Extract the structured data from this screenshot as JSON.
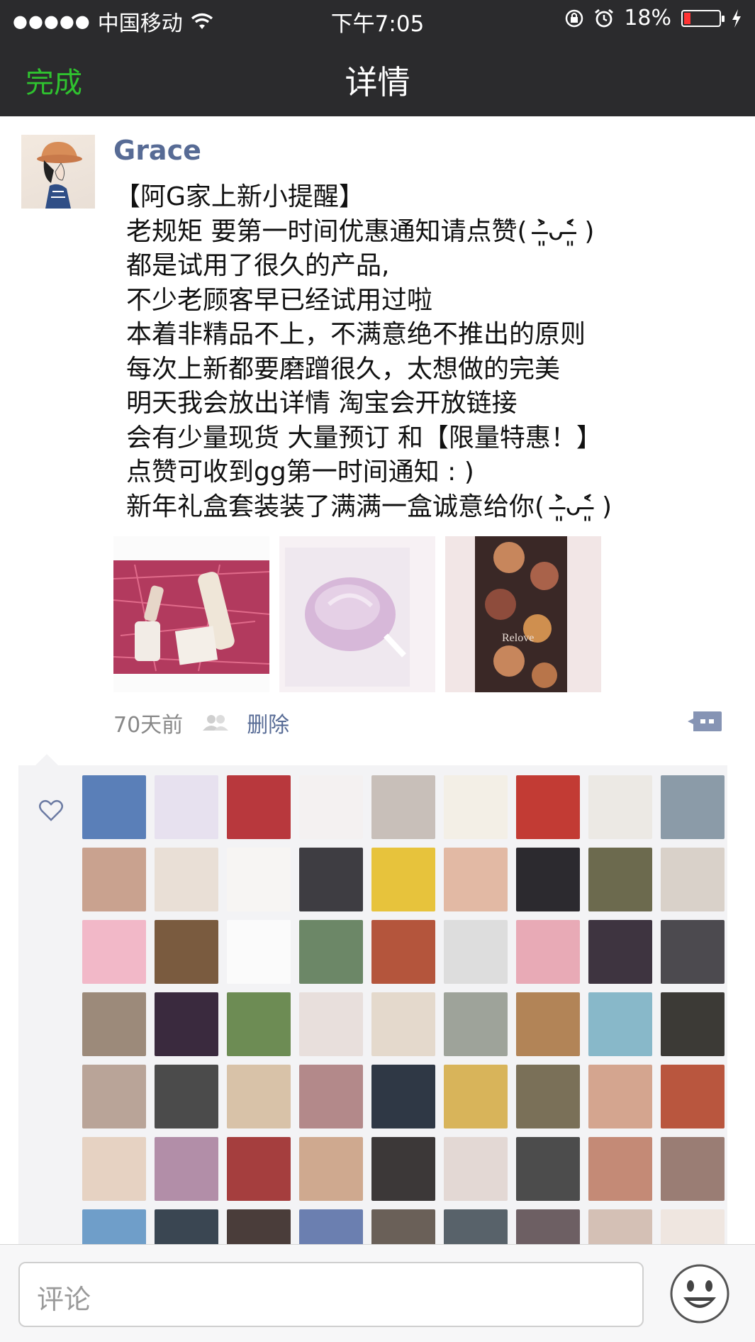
{
  "status_bar": {
    "carrier": "中国移动",
    "time": "下午7:05",
    "battery": "18%",
    "battery_level": 0.18,
    "dots": "●●●●●"
  },
  "nav": {
    "done_label": "完成",
    "title": "详情"
  },
  "post": {
    "username": "Grace",
    "lines": [
      "【阿G家上新小提醒】",
      "老规矩 要第一时间优惠通知请点赞( ˃̶͈̀ᴗ˂̶͈́ )",
      "都是试用了很久的产品,",
      "不少老顾客早已经试用过啦",
      "本着非精品不上，不满意绝不推出的原则",
      "每次上新都要磨蹭很久，太想做的完美",
      "明天我会放出详情  淘宝会开放链接",
      "会有少量现货 大量预订 和【限量特惠！】",
      "点赞可收到gg第一时间通知 : )",
      "新年礼盒套装装了满满一盒诚意给你( ˃̶͈̀ᴗ˂̶͈́ )"
    ],
    "photos": [
      {
        "name": "pink-gift-box-photo",
        "colors": [
          "#b23a5e",
          "#e06a8a",
          "#efe6d8"
        ]
      },
      {
        "name": "lilac-cream-photo",
        "colors": [
          "#efe8ef",
          "#c9a5cc",
          "#f7f1f4"
        ]
      },
      {
        "name": "brown-tins-photo",
        "colors": [
          "#3a2826",
          "#c7865c",
          "#f2e6e6"
        ],
        "overlay_text": "Relove"
      }
    ],
    "time_ago": "70天前",
    "delete_label": "删除"
  },
  "likes": {
    "rows": 7,
    "colors": [
      "#5a7fb8",
      "#e7e1ef",
      "#b8383d",
      "#f4f1f1",
      "#c8bfb9",
      "#f3efe6",
      "#c23b34",
      "#ece9e4",
      "#8b9ba8",
      "#c9a28f",
      "#e9dfd6",
      "#f7f5f3",
      "#3e3d42",
      "#e7c33c",
      "#e2b9a4",
      "#2c2a2f",
      "#6c6a4e",
      "#d9d1c9",
      "#f2b8c8",
      "#7a5b3f",
      "#fbfbfb",
      "#6c8767",
      "#b4553c",
      "#dddddd",
      "#e8aab6",
      "#3e3440",
      "#4c4a4f",
      "#9c8a7a",
      "#3a2a3e",
      "#6d8c54",
      "#e8dfdc",
      "#e4d9cc",
      "#9ea39a",
      "#b28457",
      "#88b8c9",
      "#3c3a36",
      "#b9a498",
      "#4b4b4b",
      "#d8c2a8",
      "#b3898a",
      "#2f3845",
      "#d8b45a",
      "#7a7058",
      "#d4a58f",
      "#b9563e",
      "#e6d2c2",
      "#b28ea8",
      "#a53e3e",
      "#cfa98f",
      "#3c3838",
      "#e3d8d4",
      "#4c4c4c",
      "#c48a76",
      "#9a7d74",
      "#6f9ec9",
      "#3a4652",
      "#4a3d3a",
      "#6b7fb0",
      "#6a6058",
      "#58626a",
      "#6d5f63",
      "#d4c0b5",
      "#efe6e0"
    ]
  },
  "comment": {
    "placeholder": "评论"
  }
}
